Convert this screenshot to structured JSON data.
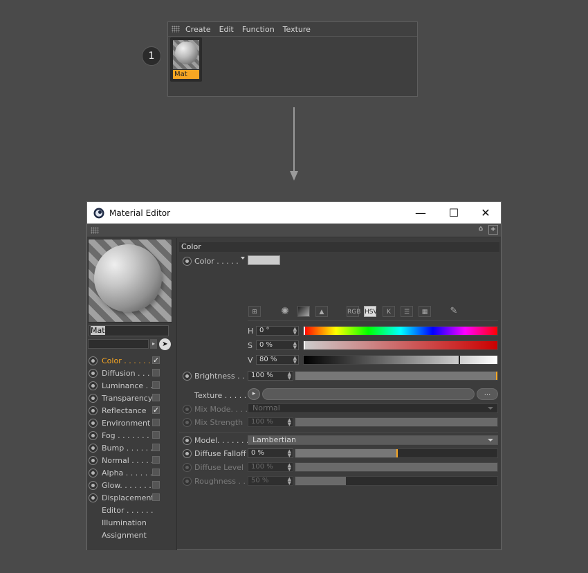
{
  "material_manager": {
    "menu": [
      "Create",
      "Edit",
      "Function",
      "Texture"
    ],
    "material": {
      "name": "Mat"
    },
    "step_badge": "1"
  },
  "editor": {
    "title": "Material Editor",
    "window_controls": {
      "minimize": "—",
      "maximize": "☐",
      "close": "✕"
    },
    "material_name": "Mat",
    "channels": [
      {
        "label": "Color . . . . . .",
        "enabled": true,
        "checked": true,
        "active": true
      },
      {
        "label": "Diffusion . . . .",
        "enabled": true,
        "checked": false
      },
      {
        "label": "Luminance . . .",
        "enabled": true,
        "checked": false
      },
      {
        "label": "Transparency",
        "enabled": true,
        "checked": false
      },
      {
        "label": "Reflectance",
        "enabled": true,
        "checked": true
      },
      {
        "label": "Environment",
        "enabled": true,
        "checked": false
      },
      {
        "label": "Fog . . . . . . . .",
        "enabled": true,
        "checked": false
      },
      {
        "label": "Bump . . . . . . .",
        "enabled": true,
        "checked": false
      },
      {
        "label": "Normal . . . . .",
        "enabled": true,
        "checked": false
      },
      {
        "label": "Alpha . . . . . .",
        "enabled": true,
        "checked": false
      },
      {
        "label": "Glow. . . . . . .",
        "enabled": true,
        "checked": false
      },
      {
        "label": "Displacement",
        "enabled": true,
        "checked": false
      },
      {
        "label": "Editor . . . . . .",
        "plain": true
      },
      {
        "label": "Illumination",
        "plain": true
      },
      {
        "label": "Assignment",
        "plain": true
      }
    ],
    "color_section": {
      "header": "Color",
      "color_label": "Color . . . . .",
      "color_swatch": "#cccccc",
      "mode_icons": [
        "RGB",
        "HSV",
        "K"
      ],
      "h_label": "H",
      "h_value": "0 °",
      "s_label": "S",
      "s_value": "0 %",
      "v_label": "V",
      "v_value": "80 %",
      "v_level": 0.8,
      "brightness_label": "Brightness . . .",
      "brightness_value": "100 %",
      "brightness_level": 1.0,
      "texture_label": "Texture . . . . . .",
      "texture_more": "...",
      "mix_mode_label": "Mix Mode. . . . .",
      "mix_mode_value": "Normal",
      "mix_strength_label": "Mix Strength",
      "mix_strength_value": "100 %",
      "model_label": "Model. . . . . . .",
      "model_value": "Lambertian",
      "diffuse_falloff_label": "Diffuse Falloff",
      "diffuse_falloff_value": "0 %",
      "diffuse_falloff_level": 0.5,
      "diffuse_level_label": "Diffuse Level",
      "diffuse_level_value": "100 %",
      "roughness_label": "Roughness . .",
      "roughness_value": "50 %",
      "roughness_level": 0.25
    }
  },
  "colors": {
    "accent": "#f6a623",
    "window_bg": "#3c3c3c",
    "page_bg": "#4a4a4a"
  }
}
